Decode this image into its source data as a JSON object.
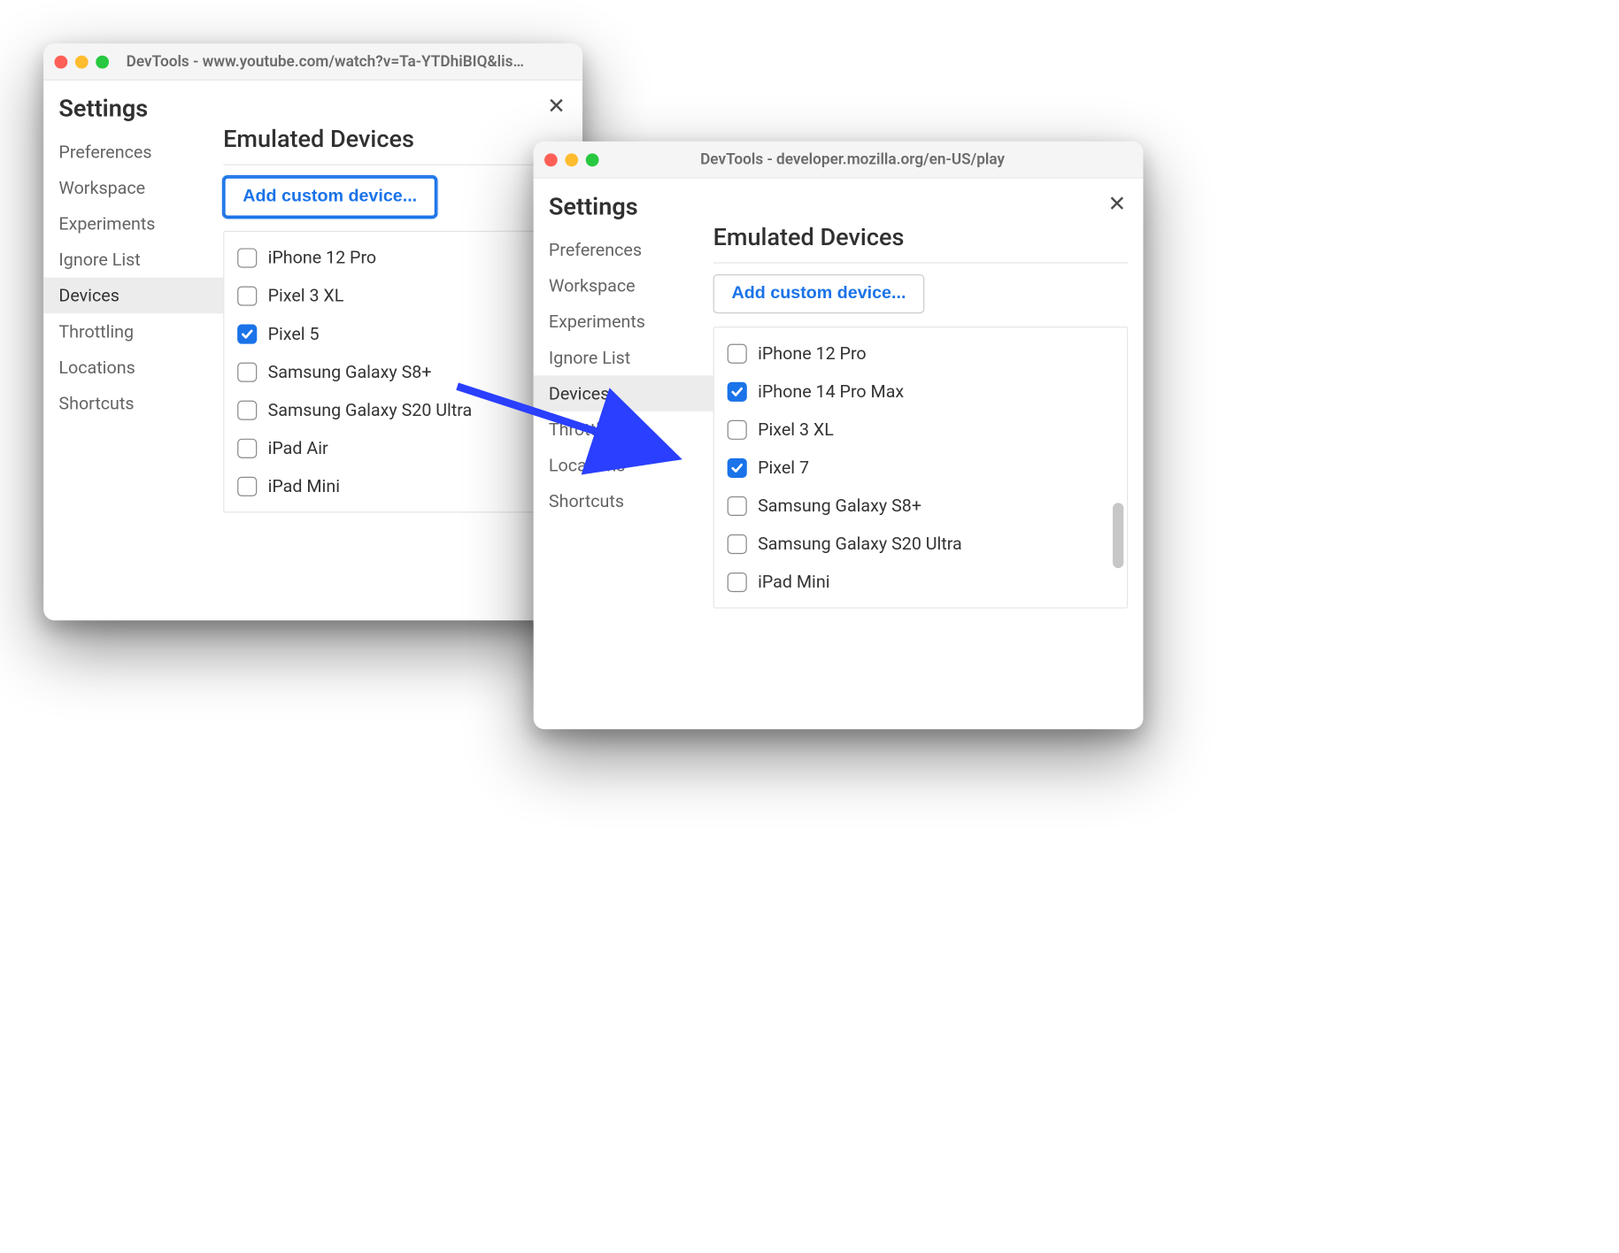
{
  "windowA": {
    "title": "DevTools - www.youtube.com/watch?v=Ta-YTDhiBIQ&list=PL...",
    "settingsLabel": "Settings",
    "nav": [
      "Preferences",
      "Workspace",
      "Experiments",
      "Ignore List",
      "Devices",
      "Throttling",
      "Locations",
      "Shortcuts"
    ],
    "selectedNavIndex": 4,
    "mainHeading": "Emulated Devices",
    "addBtnLabel": "Add custom device...",
    "addBtnFocused": true,
    "devices": [
      {
        "label": "iPhone 12 Pro",
        "checked": false
      },
      {
        "label": "Pixel 3 XL",
        "checked": false
      },
      {
        "label": "Pixel 5",
        "checked": true
      },
      {
        "label": "Samsung Galaxy S8+",
        "checked": false
      },
      {
        "label": "Samsung Galaxy S20 Ultra",
        "checked": false
      },
      {
        "label": "iPad Air",
        "checked": false
      },
      {
        "label": "iPad Mini",
        "checked": false
      }
    ]
  },
  "windowB": {
    "title": "DevTools - developer.mozilla.org/en-US/play",
    "settingsLabel": "Settings",
    "nav": [
      "Preferences",
      "Workspace",
      "Experiments",
      "Ignore List",
      "Devices",
      "Throttling",
      "Locations",
      "Shortcuts"
    ],
    "selectedNavIndex": 4,
    "mainHeading": "Emulated Devices",
    "addBtnLabel": "Add custom device...",
    "addBtnFocused": false,
    "devices": [
      {
        "label": "iPhone 12 Pro",
        "checked": false
      },
      {
        "label": "iPhone 14 Pro Max",
        "checked": true
      },
      {
        "label": "Pixel 3 XL",
        "checked": false
      },
      {
        "label": "Pixel 7",
        "checked": true
      },
      {
        "label": "Samsung Galaxy S8+",
        "checked": false
      },
      {
        "label": "Samsung Galaxy S20 Ultra",
        "checked": false
      },
      {
        "label": "iPad Mini",
        "checked": false
      }
    ]
  }
}
